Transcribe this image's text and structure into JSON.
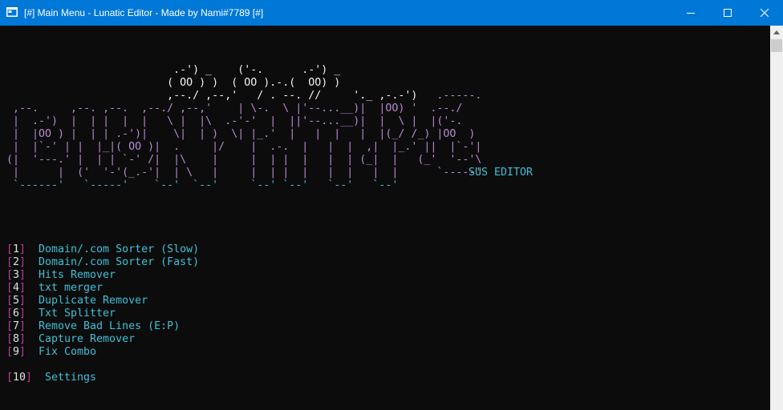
{
  "window": {
    "title": "[#] Main Menu - Lunatic Editor - Made by Nami#7789 [#]",
    "icon": "console-app-icon",
    "controls": [
      "minimize-icon",
      "maximize-icon",
      "close-icon"
    ]
  },
  "banner": {
    "subtitle": "SUS EDITOR"
  },
  "menu": {
    "items": [
      {
        "num": "1",
        "label": "Domain/.com Sorter (Slow)"
      },
      {
        "num": "2",
        "label": "Domain/.com Sorter (Fast)"
      },
      {
        "num": "3",
        "label": "Hits Remover"
      },
      {
        "num": "4",
        "label": "txt merger"
      },
      {
        "num": "5",
        "label": "Duplicate Remover"
      },
      {
        "num": "6",
        "label": "Txt Splitter"
      },
      {
        "num": "7",
        "label": "Remove Bad Lines (E:P)"
      },
      {
        "num": "8",
        "label": "Capture Remover"
      },
      {
        "num": "9",
        "label": "Fix Combo"
      }
    ],
    "settings": {
      "num": "10",
      "label": "Settings"
    }
  },
  "colors": {
    "titlebar": "#0078d7",
    "console_bg": "#0c0c0c",
    "bracket": "#c0399b",
    "label": "#3fc0d6",
    "art": "#b78ad0"
  }
}
